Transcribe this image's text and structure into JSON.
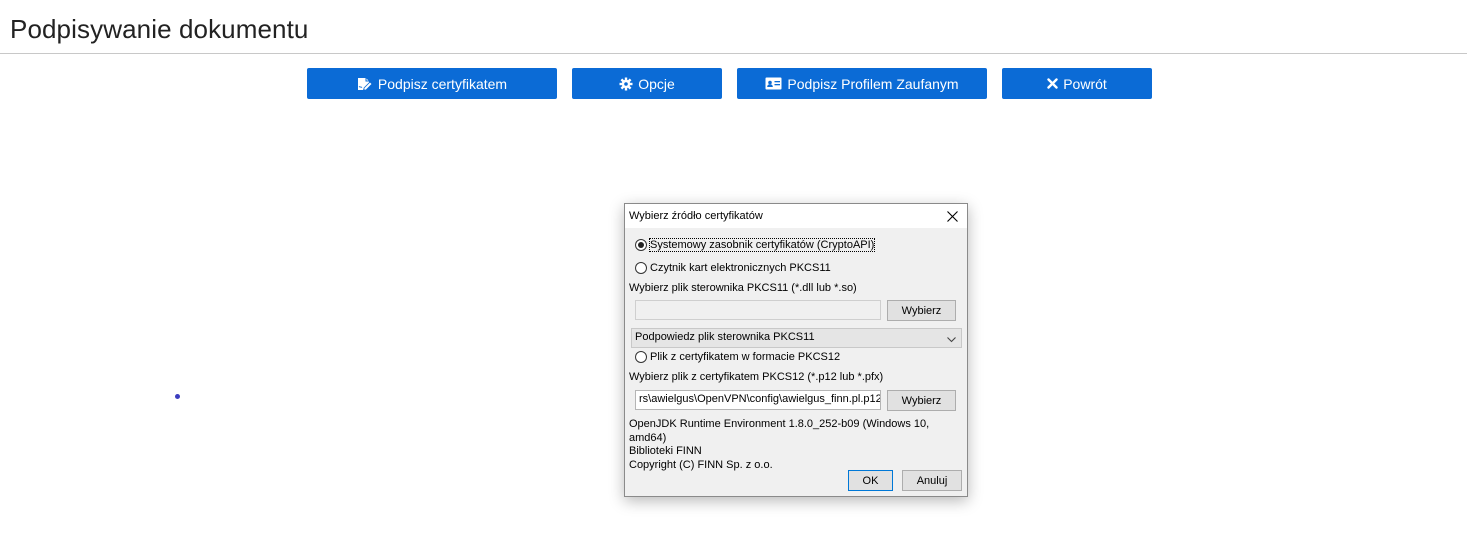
{
  "page": {
    "title": "Podpisywanie dokumentu"
  },
  "toolbar": {
    "sign_cert_label": "Podpisz certyfikatem",
    "options_label": "Opcje",
    "sign_profile_label": "Podpisz Profilem Zaufanym",
    "back_label": "Powrót",
    "button_color": "#0b6bd6",
    "icons": [
      "signature-icon",
      "gear-icon",
      "id-card-icon",
      "close-icon"
    ]
  },
  "dialog": {
    "title": "Wybierz źródło certyfikatów",
    "radio_system": "Systemowy zasobnik certyfikatów (CryptoAPI)",
    "radio_system_selected": true,
    "radio_pkcs11": "Czytnik kart elektronicznych PKCS11",
    "pkcs11_file_label": "Wybierz plik sterownika PKCS11 (*.dll lub *.so)",
    "pkcs11_file_value": "",
    "choose_label": "Wybierz",
    "pkcs11_hint_selected": "Podpowiedz plik sterownika PKCS11",
    "radio_pkcs12": "Plik z certyfikatem w formacie PKCS12",
    "pkcs12_file_label": "Wybierz plik z certyfikatem PKCS12 (*.p12 lub *.pfx)",
    "pkcs12_file_value": "rs\\awielgus\\OpenVPN\\config\\awielgus_finn.pl.p12",
    "info_runtime": "OpenJDK Runtime Environment 1.8.0_252-b09 (Windows 10, amd64)",
    "info_library": "Biblioteki FINN",
    "info_copyright": "Copyright (C) FINN Sp. z o.o.",
    "ok_label": "OK",
    "cancel_label": "Anuluj"
  }
}
